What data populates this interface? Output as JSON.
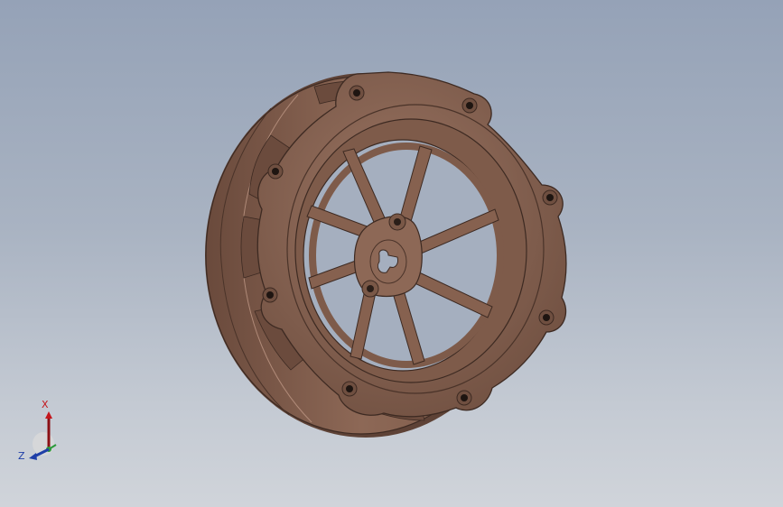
{
  "viewport": {
    "background_top": "#95a2b7",
    "background_bottom": "#d0d4da"
  },
  "model": {
    "material_color": "#8a6553",
    "shadow_color": "#5e4236",
    "highlight_color": "#b08a78"
  },
  "triad": {
    "x_label": "X",
    "z_label": "Z",
    "x_color": "#c4161c",
    "y_color": "#2b9a3a",
    "z_color": "#1f3fa8"
  }
}
